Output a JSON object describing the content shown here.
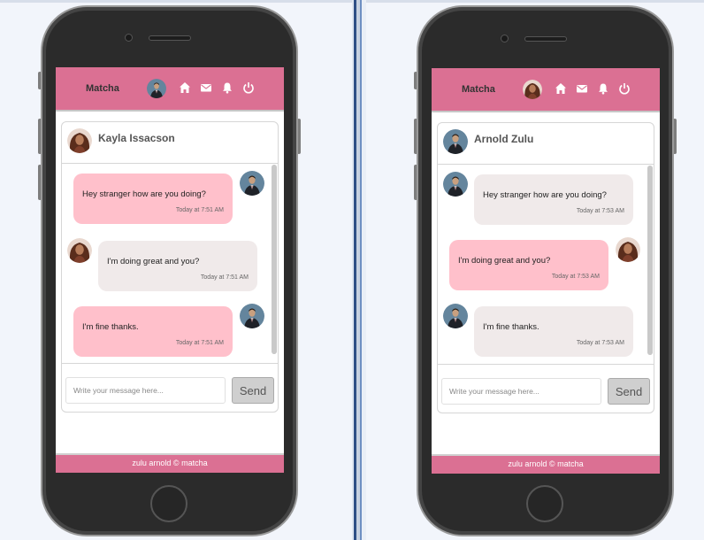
{
  "app": {
    "brand": "Matcha",
    "footer": "zulu arnold © matcha",
    "colors": {
      "accent": "#db7093",
      "bubble_sent": "#ffc0cb",
      "bubble_received": "#f0eaea"
    },
    "nav_icons": [
      "home-icon",
      "mail-icon",
      "bell-icon",
      "power-icon"
    ]
  },
  "phones": [
    {
      "chat_with": "Kayla Issacson",
      "messages": [
        {
          "text": "Hey stranger how are you doing?",
          "time": "Today at 7:51 AM"
        },
        {
          "text": "I'm doing great and you?",
          "time": "Today at 7:51 AM"
        },
        {
          "text": "I'm fine thanks.",
          "time": "Today at 7:51 AM"
        }
      ],
      "input_placeholder": "Write your message here...",
      "send_label": "Send"
    },
    {
      "chat_with": "Arnold Zulu",
      "messages": [
        {
          "text": "Hey stranger how are you doing?",
          "time": "Today at 7:53 AM"
        },
        {
          "text": "I'm doing great and you?",
          "time": "Today at 7:53 AM"
        },
        {
          "text": "I'm fine thanks.",
          "time": "Today at 7:53 AM"
        }
      ],
      "input_placeholder": "Write your message here...",
      "send_label": "Send"
    }
  ]
}
